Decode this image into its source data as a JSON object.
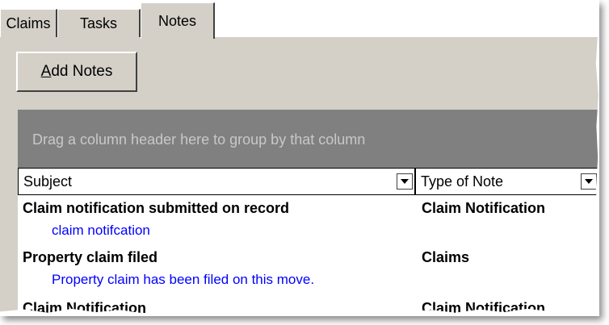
{
  "tabs": [
    {
      "label": "Claims",
      "active": false
    },
    {
      "label": "Tasks",
      "active": false
    },
    {
      "label": "Notes",
      "active": true
    }
  ],
  "toolbar": {
    "add_notes_accel": "A",
    "add_notes_rest": "dd Notes"
  },
  "grid": {
    "group_hint": "Drag a column header here to group by that column",
    "columns": [
      {
        "label": "Subject"
      },
      {
        "label": "Type of Note"
      }
    ],
    "rows": [
      {
        "subject": "Claim notification submitted on record",
        "type": "Claim Notification",
        "detail": "claim notifcation"
      },
      {
        "subject": "Property claim filed",
        "type": "Claims",
        "detail": "Property claim has been filed on this move."
      },
      {
        "subject": "Claim Notification",
        "type": "Claim Notification",
        "detail": ""
      }
    ]
  },
  "colors": {
    "window_bg": "#d4d0c8",
    "group_panel": "#808080",
    "detail_text": "#0000ff"
  }
}
